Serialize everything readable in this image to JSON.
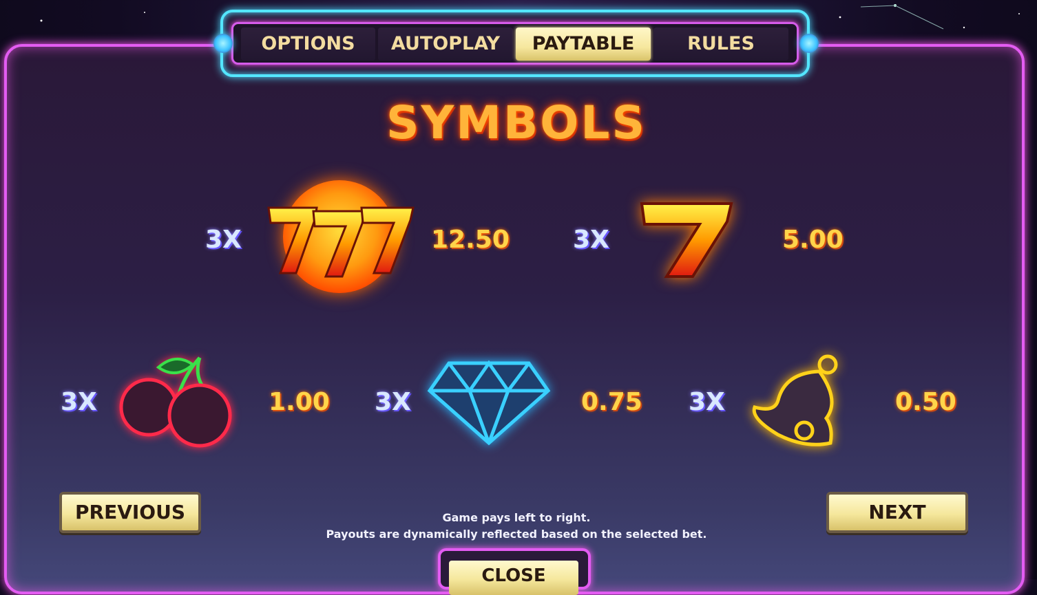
{
  "tabs": [
    {
      "label": "OPTIONS",
      "active": false
    },
    {
      "label": "AUTOPLAY",
      "active": false
    },
    {
      "label": "PAYTABLE",
      "active": true
    },
    {
      "label": "RULES",
      "active": false
    }
  ],
  "title": "SYMBOLS",
  "symbols": [
    {
      "icon": "triple-seven-icon",
      "multiplier": "3X",
      "payout": "12.50"
    },
    {
      "icon": "seven-icon",
      "multiplier": "3X",
      "payout": "5.00"
    },
    {
      "icon": "cherry-icon",
      "multiplier": "3X",
      "payout": "1.00"
    },
    {
      "icon": "diamond-icon",
      "multiplier": "3X",
      "payout": "0.75"
    },
    {
      "icon": "bell-icon",
      "multiplier": "3X",
      "payout": "0.50"
    }
  ],
  "buttons": {
    "previous": "PREVIOUS",
    "next": "NEXT",
    "close": "CLOSE"
  },
  "footer": {
    "line1": "Game pays left to right.",
    "line2": "Payouts are dynamically reflected based on the selected bet."
  },
  "colors": {
    "panel_border": "#e35cf2",
    "tab_border": "#54e6ff",
    "button": "#f5e79c",
    "payout": "#ffd44a"
  }
}
